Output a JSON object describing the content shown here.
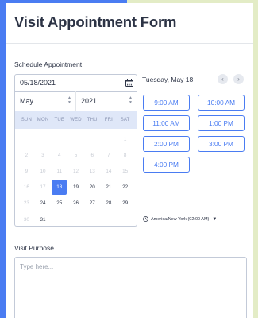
{
  "form": {
    "title": "Visit Appointment Form"
  },
  "schedule": {
    "label": "Schedule Appointment",
    "date_value": "05/18/2021",
    "month": "May",
    "year": "2021",
    "weekdays": [
      "SUN",
      "MON",
      "TUE",
      "WED",
      "THU",
      "FRI",
      "SAT"
    ],
    "weeks": [
      [
        {
          "d": "",
          "s": "dis"
        },
        {
          "d": "",
          "s": "dis"
        },
        {
          "d": "",
          "s": "dis"
        },
        {
          "d": "",
          "s": "dis"
        },
        {
          "d": "",
          "s": "dis"
        },
        {
          "d": "",
          "s": "dis"
        },
        {
          "d": "1",
          "s": "dis"
        }
      ],
      [
        {
          "d": "2",
          "s": "dis"
        },
        {
          "d": "3",
          "s": "dis"
        },
        {
          "d": "4",
          "s": "dis"
        },
        {
          "d": "5",
          "s": "dis"
        },
        {
          "d": "6",
          "s": "dis"
        },
        {
          "d": "7",
          "s": "dis"
        },
        {
          "d": "8",
          "s": "dis"
        }
      ],
      [
        {
          "d": "9",
          "s": "dis"
        },
        {
          "d": "10",
          "s": "dis"
        },
        {
          "d": "11",
          "s": "dis"
        },
        {
          "d": "12",
          "s": "dis"
        },
        {
          "d": "13",
          "s": "dis"
        },
        {
          "d": "14",
          "s": "dis"
        },
        {
          "d": "15",
          "s": "dis"
        }
      ],
      [
        {
          "d": "16",
          "s": "dis"
        },
        {
          "d": "17",
          "s": "dis"
        },
        {
          "d": "18",
          "s": "selected"
        },
        {
          "d": "19",
          "s": "avail"
        },
        {
          "d": "20",
          "s": "avail"
        },
        {
          "d": "21",
          "s": "avail"
        },
        {
          "d": "22",
          "s": "avail"
        }
      ],
      [
        {
          "d": "23",
          "s": "dis"
        },
        {
          "d": "24",
          "s": "avail"
        },
        {
          "d": "25",
          "s": "avail"
        },
        {
          "d": "26",
          "s": "avail"
        },
        {
          "d": "27",
          "s": "avail"
        },
        {
          "d": "28",
          "s": "avail"
        },
        {
          "d": "29",
          "s": "avail"
        }
      ],
      [
        {
          "d": "30",
          "s": "dis"
        },
        {
          "d": "31",
          "s": "avail"
        }
      ]
    ],
    "selected_date_heading": "Tuesday, May 18",
    "time_slots": [
      "9:00 AM",
      "10:00 AM",
      "11:00 AM",
      "1:00 PM",
      "2:00 PM",
      "3:00 PM",
      "4:00 PM"
    ],
    "timezone": "America/New York (02:00 AM)"
  },
  "purpose": {
    "label": "Visit Purpose",
    "placeholder": "Type here..."
  },
  "colors": {
    "accent": "#4a7cf2",
    "weekday_bar": "#dfe7f8",
    "text": "#2c3345"
  },
  "icons": {
    "calendar": "calendar-icon",
    "prev": "chevron-left-icon",
    "next": "chevron-right-icon",
    "timezone": "clock-icon"
  }
}
